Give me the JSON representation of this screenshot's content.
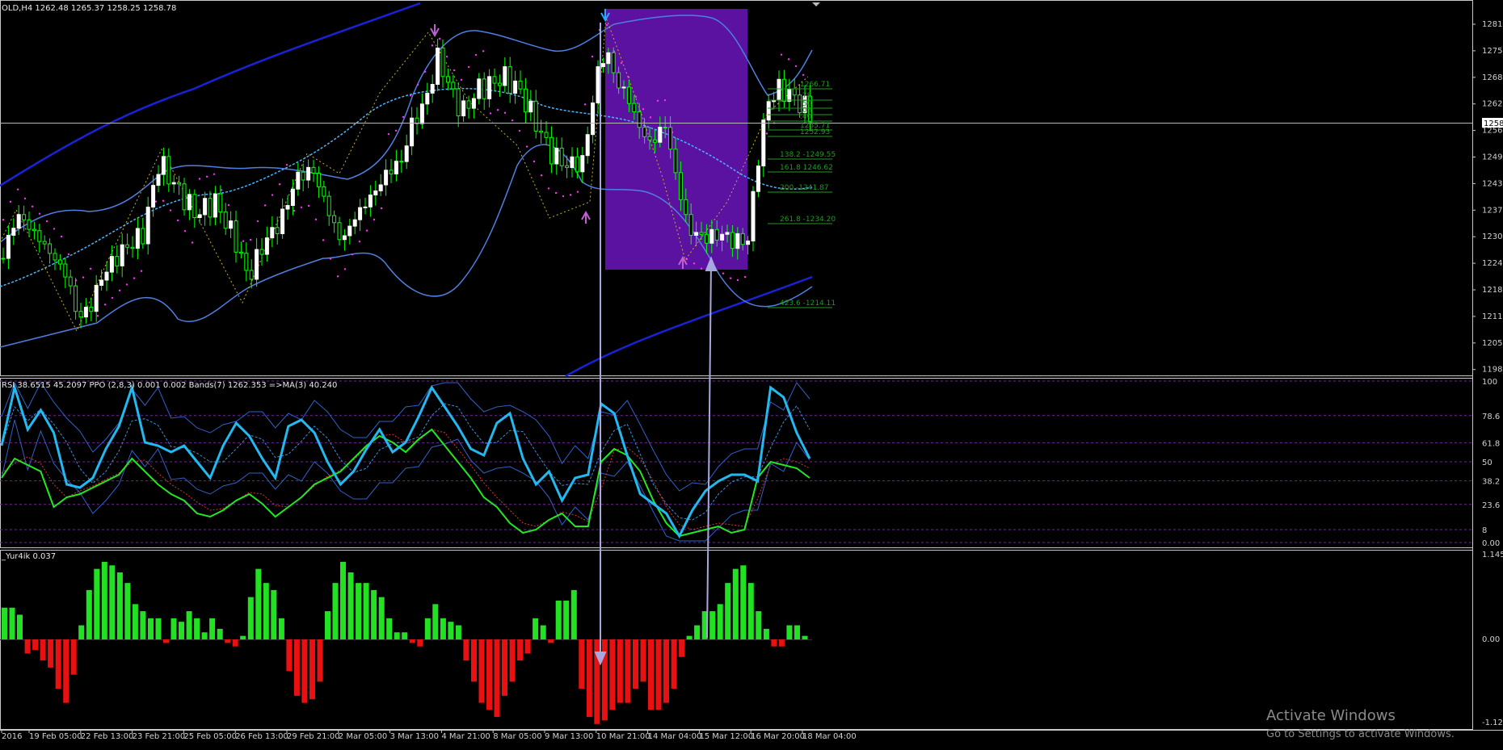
{
  "window": {
    "title": "OLD,H4 1262.48 1265.37 1258.25 1258.78"
  },
  "colors": {
    "background": "#000000",
    "bull_candle": "#ffffff",
    "bear_candle": "#00ff00",
    "bollinger": "#4f7fe0",
    "envelope": "#1a22d8",
    "ma_dashed": "#49b6ff",
    "sar": "#ff2fff",
    "highlight_box": "#5c12a0",
    "rsi_line": "#22b8f0",
    "ppo_line": "#22e822",
    "hist_up": "#22e022",
    "hist_down": "#e81010",
    "arrow": "#a8a8e0",
    "fib_text": "#1f9a1f"
  },
  "main_chart": {
    "price_axis": [
      "1281.",
      "1275.",
      "1268.",
      "1262.",
      "1256.",
      "1249.",
      "1243.",
      "1237.",
      "1230.",
      "1224.",
      "1218.",
      "1211.",
      "1205.",
      "1198."
    ],
    "current_price": "1258.",
    "fib_levels": [
      {
        "label": "1266.71"
      },
      {
        "label": ".78"
      },
      {
        "label": ".50"
      },
      {
        "label": ".03"
      },
      {
        "label": ".40"
      },
      {
        "label": "1255.71"
      },
      {
        "label": "1252.93"
      },
      {
        "label": "138.2  -1249.55"
      },
      {
        "label": "161.8 1246.62"
      },
      {
        "label": "200  -1241.87"
      },
      {
        "label": "261.8 -1234.20"
      },
      {
        "label": "423.6 -1214.11"
      }
    ]
  },
  "rsi_panel": {
    "title": "RSI 38.6515 45.2097  PPO (2,8,3) 0.001 0.002  Bands(7) 1262.353  =>MA(3) 40.240",
    "axis": [
      "100",
      "78.6",
      "61.8",
      "50",
      "38.2",
      "23.6",
      "8",
      "0.00"
    ]
  },
  "hist_panel": {
    "title": "_Yur4ik 0.037",
    "axis": [
      "1.145",
      "0.00",
      "-1.125"
    ]
  },
  "time_axis": [
    "2016",
    "19 Feb 05:00",
    "22 Feb 13:00",
    "23 Feb 21:00",
    "25 Feb 05:00",
    "26 Feb 13:00",
    "29 Feb 21:00",
    "2 Mar 05:00",
    "3 Mar 13:00",
    "4 Mar 21:00",
    "8 Mar 05:00",
    "9 Mar 13:00",
    "10 Mar 21:00",
    "14 Mar 04:00",
    "15 Mar 12:00",
    "16 Mar 20:00",
    "18 Mar 04:00"
  ],
  "watermark": {
    "line1": "Activate Windows",
    "line2": "Go to Settings to activate Windows."
  }
}
